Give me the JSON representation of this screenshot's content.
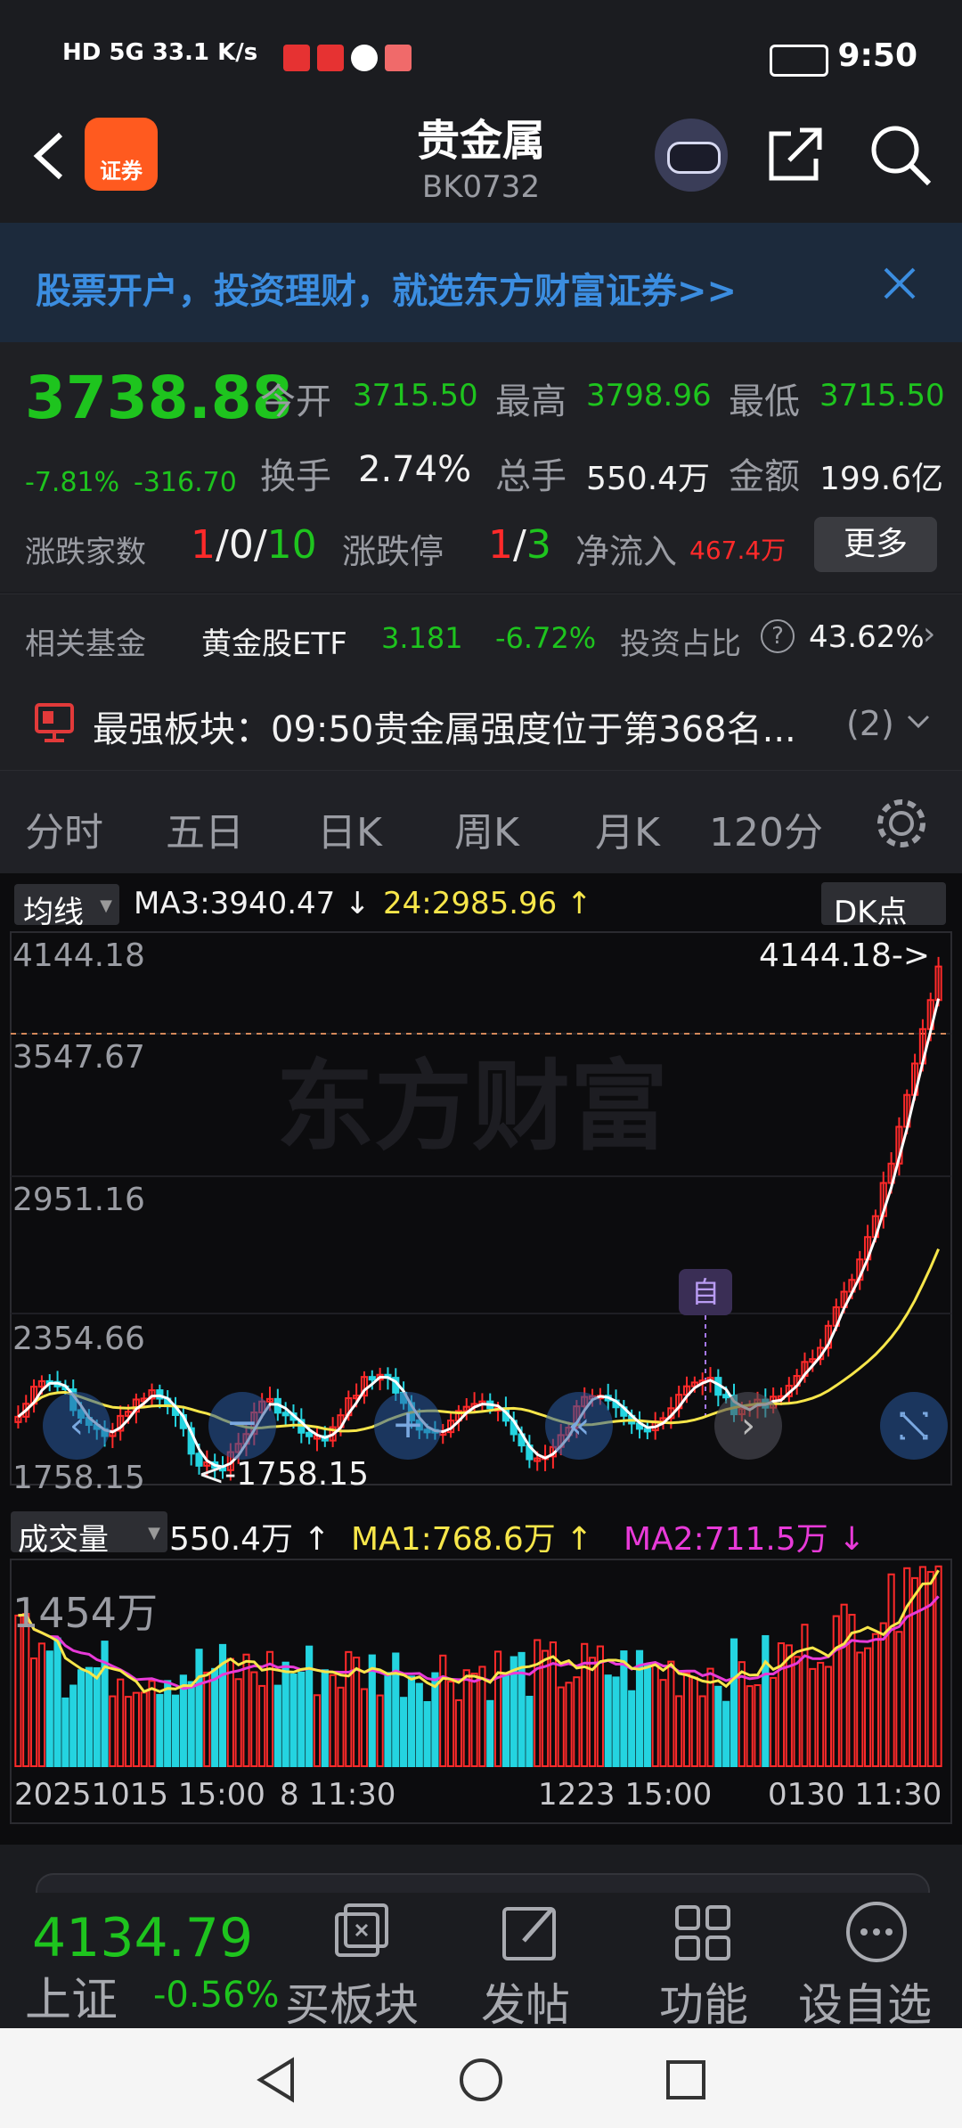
{
  "status": {
    "left": "HD 5G 33.1 K/s",
    "time": "9:50"
  },
  "nav": {
    "logo_text": "证券",
    "title": "贵金属",
    "code": "BK0732"
  },
  "banner": {
    "text": "股票开户，投资理财，就选东方财富证券>>"
  },
  "quote": {
    "price": "3738.88",
    "change_pct": "-7.81%",
    "change": "-316.70",
    "open_label": "今开",
    "open": "3715.50",
    "high_label": "最高",
    "high": "3798.96",
    "low_label": "最低",
    "low": "3715.50",
    "turnover_label": "换手",
    "turnover": "2.74%",
    "volume_label": "总手",
    "volume": "550.4万",
    "amount_label": "金额",
    "amount": "199.6亿",
    "updown_label": "涨跌家数",
    "up": "1",
    "flat": "0",
    "down": "10",
    "limit_label": "涨跌停",
    "limit_up": "1",
    "limit_down": "3",
    "inflow_label": "净流入",
    "inflow": "467.4万",
    "more": "更多"
  },
  "fund": {
    "label": "相关基金",
    "name": "黄金股ETF",
    "price": "3.181",
    "pct": "-6.72%",
    "ratio_label": "投资占比",
    "ratio": "43.62%"
  },
  "strong": {
    "text": "最强板块：09:50贵金属强度位于第368名...",
    "count": "(2)"
  },
  "tabs": [
    "分时",
    "五日",
    "日K",
    "周K",
    "月K",
    "120分"
  ],
  "chart": {
    "ma_selector": "均线",
    "ma3": "MA3:3940.47 ↓",
    "ma24": "24:2985.96 ↑",
    "dk": "DK点",
    "y_labels": [
      "4144.18",
      "3547.67",
      "2951.16",
      "2354.66",
      "1758.15"
    ],
    "max_marker": "4144.18->",
    "min_marker": "<-1758.15",
    "self_marker": "自",
    "watermark": "东方财富",
    "vol_selector": "成交量",
    "vol_value": "550.4万 ↑",
    "vol_ma1": "MA1:768.6万 ↑",
    "vol_ma2": "MA2:711.5万 ↓",
    "vol_max": "1454万",
    "x_labels": [
      "20251015 15:00",
      "8 11:30",
      "1223 15:00",
      "0130 11:30"
    ],
    "colors": {
      "up": "#ff2a2a",
      "down": "#24d4e0",
      "ma_short": "#ffffff",
      "ma_long": "#f7e64a",
      "vol_ma2": "#e83ad8"
    }
  },
  "bottom": {
    "index_price": "4134.79",
    "index_name": "上证",
    "index_pct": "-0.56%",
    "buy": "买板块",
    "post": "发帖",
    "func": "功能",
    "add": "设自选"
  }
}
